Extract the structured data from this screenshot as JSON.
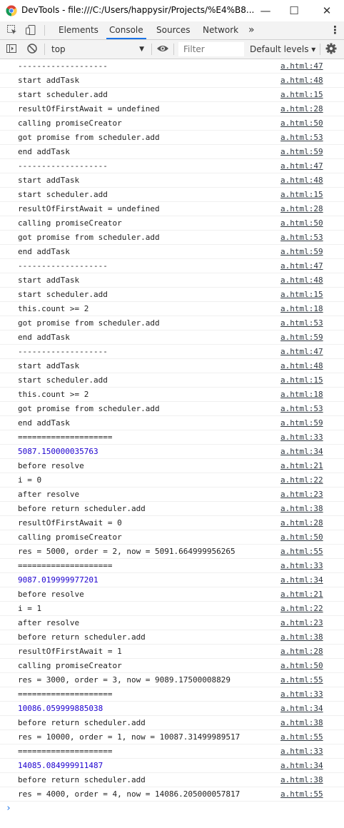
{
  "window": {
    "title": "DevTools - file:///C:/Users/happysir/Projects/%E4%B8...",
    "minimize": "—",
    "maximize": "☐",
    "close": "✕"
  },
  "tabs": {
    "items": [
      {
        "label": "Elements"
      },
      {
        "label": "Console"
      },
      {
        "label": "Sources"
      },
      {
        "label": "Network"
      }
    ],
    "active": "Console",
    "more": "»",
    "menu": "⋮"
  },
  "toolbar": {
    "context": "top",
    "context_arrow": "▼",
    "filter_placeholder": "Filter",
    "levels": "Default levels ▾"
  },
  "console": {
    "messages": [
      {
        "text": "-------------------",
        "source": "a.html:47"
      },
      {
        "text": "start addTask",
        "source": "a.html:48"
      },
      {
        "text": "start scheduler.add",
        "source": "a.html:15"
      },
      {
        "text": "resultOfFirstAwait = undefined",
        "source": "a.html:28"
      },
      {
        "text": "calling promiseCreator",
        "source": "a.html:50"
      },
      {
        "text": "got promise from scheduler.add",
        "source": "a.html:53"
      },
      {
        "text": "end addTask",
        "source": "a.html:59"
      },
      {
        "text": "-------------------",
        "source": "a.html:47"
      },
      {
        "text": "start addTask",
        "source": "a.html:48"
      },
      {
        "text": "start scheduler.add",
        "source": "a.html:15"
      },
      {
        "text": "resultOfFirstAwait = undefined",
        "source": "a.html:28"
      },
      {
        "text": "calling promiseCreator",
        "source": "a.html:50"
      },
      {
        "text": "got promise from scheduler.add",
        "source": "a.html:53"
      },
      {
        "text": "end addTask",
        "source": "a.html:59"
      },
      {
        "text": "-------------------",
        "source": "a.html:47"
      },
      {
        "text": "start addTask",
        "source": "a.html:48"
      },
      {
        "text": "start scheduler.add",
        "source": "a.html:15"
      },
      {
        "text": "this.count >= 2",
        "source": "a.html:18"
      },
      {
        "text": "got promise from scheduler.add",
        "source": "a.html:53"
      },
      {
        "text": "end addTask",
        "source": "a.html:59"
      },
      {
        "text": "-------------------",
        "source": "a.html:47"
      },
      {
        "text": "start addTask",
        "source": "a.html:48"
      },
      {
        "text": "start scheduler.add",
        "source": "a.html:15"
      },
      {
        "text": "this.count >= 2",
        "source": "a.html:18"
      },
      {
        "text": "got promise from scheduler.add",
        "source": "a.html:53"
      },
      {
        "text": "end addTask",
        "source": "a.html:59"
      },
      {
        "text": "====================",
        "source": "a.html:33"
      },
      {
        "text": "5087.150000035763",
        "source": "a.html:34",
        "type": "number"
      },
      {
        "text": "before resolve",
        "source": "a.html:21"
      },
      {
        "text": "i = 0",
        "source": "a.html:22"
      },
      {
        "text": "after resolve",
        "source": "a.html:23"
      },
      {
        "text": "before return scheduler.add",
        "source": "a.html:38"
      },
      {
        "text": "resultOfFirstAwait = 0",
        "source": "a.html:28"
      },
      {
        "text": "calling promiseCreator",
        "source": "a.html:50"
      },
      {
        "text": "res = 5000, order = 2, now = 5091.664999956265",
        "source": "a.html:55"
      },
      {
        "text": "====================",
        "source": "a.html:33"
      },
      {
        "text": "9087.019999977201",
        "source": "a.html:34",
        "type": "number"
      },
      {
        "text": "before resolve",
        "source": "a.html:21"
      },
      {
        "text": "i = 1",
        "source": "a.html:22"
      },
      {
        "text": "after resolve",
        "source": "a.html:23"
      },
      {
        "text": "before return scheduler.add",
        "source": "a.html:38"
      },
      {
        "text": "resultOfFirstAwait = 1",
        "source": "a.html:28"
      },
      {
        "text": "calling promiseCreator",
        "source": "a.html:50"
      },
      {
        "text": "res = 3000, order = 3, now = 9089.17500008829",
        "source": "a.html:55"
      },
      {
        "text": "====================",
        "source": "a.html:33"
      },
      {
        "text": "10086.059999885038",
        "source": "a.html:34",
        "type": "number"
      },
      {
        "text": "before return scheduler.add",
        "source": "a.html:38"
      },
      {
        "text": "res = 10000, order = 1, now = 10087.31499989517",
        "source": "a.html:55"
      },
      {
        "text": "====================",
        "source": "a.html:33"
      },
      {
        "text": "14085.084999911487",
        "source": "a.html:34",
        "type": "number"
      },
      {
        "text": "before return scheduler.add",
        "source": "a.html:38"
      },
      {
        "text": "res = 4000, order = 4, now = 14086.205000057817",
        "source": "a.html:55"
      }
    ],
    "prompt": "›"
  },
  "colors": {
    "tab_accent": "#1a73e8",
    "number_text": "#1c00cf",
    "toolbar_bg": "#f3f3f3"
  }
}
